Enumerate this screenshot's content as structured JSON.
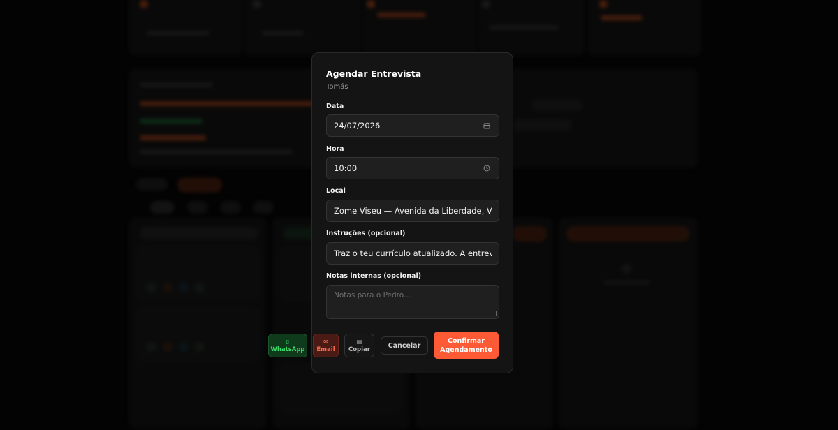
{
  "modal": {
    "title": "Agendar Entrevista",
    "candidate": "Tomás",
    "date": {
      "label": "Data",
      "value": "24/07/2026",
      "icon": "calendar-icon"
    },
    "time": {
      "label": "Hora",
      "value": "10:00",
      "icon": "clock-icon"
    },
    "location": {
      "label": "Local",
      "value": "Zome Viseu — Avenida da Liberdade, Viseu"
    },
    "instructions": {
      "label": "Instruções (opcional)",
      "value": "Traz o teu currículo atualizado. A entrevista"
    },
    "notes": {
      "label": "Notas internas (opcional)",
      "placeholder": "Notas para o Pedro..."
    }
  },
  "actions": {
    "whatsapp": {
      "label": "WhatsApp",
      "icon": "phone-icon",
      "color": "#3ddc6a"
    },
    "email": {
      "label": "Email",
      "icon": "envelope-icon",
      "color": "#ff6b4e"
    },
    "copy": {
      "label": "Copiar",
      "icon": "clipboard-icon"
    },
    "cancel": {
      "label": "Cancelar"
    },
    "confirm": {
      "line1": "Confirmar",
      "line2": "Agendamento",
      "color": "#ff5a36"
    }
  }
}
